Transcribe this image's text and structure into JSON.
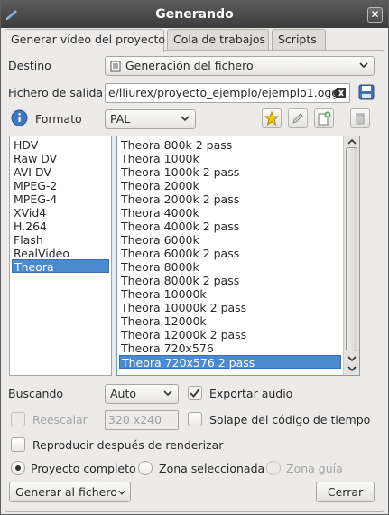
{
  "window": {
    "title": "Generando"
  },
  "tabs": [
    {
      "label": "Generar vídeo del proyecto"
    },
    {
      "label": "Cola de trabajos"
    },
    {
      "label": "Scripts"
    }
  ],
  "destination": {
    "label": "Destino",
    "value": "Generación del fichero"
  },
  "output_file": {
    "label": "Fichero de salida",
    "value": "e/lliurex/proyecto_ejemplo/ejemplo1.ogg"
  },
  "format": {
    "label": "Formato",
    "value": "PAL"
  },
  "categories": [
    "HDV",
    "Raw DV",
    "AVI DV",
    "MPEG-2",
    "MPEG-4",
    "XVid4",
    "H.264",
    "Flash",
    "RealVideo",
    "Theora"
  ],
  "selected_category": "Theora",
  "profiles": [
    "Theora 800k 2 pass",
    "Theora 1000k",
    "Theora 1000k 2 pass",
    "Theora 2000k",
    "Theora 2000k 2 pass",
    "Theora 4000k",
    "Theora 4000k 2 pass",
    "Theora 6000k",
    "Theora 6000k 2 pass",
    "Theora 8000k",
    "Theora 8000k 2 pass",
    "Theora 10000k",
    "Theora 10000k 2 pass",
    "Theora 12000k",
    "Theora 12000k 2 pass",
    "Theora 720x576",
    "Theora 720x576 2 pass"
  ],
  "selected_profile": "Theora 720x576 2 pass",
  "search": {
    "label": "Buscando",
    "value": "Auto"
  },
  "export_audio": {
    "label": "Exportar audio",
    "checked": true
  },
  "rescale": {
    "label": "Reescalar",
    "value": "320 x240",
    "checked": false
  },
  "timecode_overlay": {
    "label": "Solape del código de tiempo",
    "checked": false
  },
  "play_after": {
    "label": "Reproducir después de renderizar",
    "checked": false
  },
  "range": {
    "full_project": "Proyecto completo",
    "selected_zone": "Zona seleccionada",
    "guide_zone": "Zona guía"
  },
  "buttons": {
    "render": "Generar al fichero",
    "close": "Cerrar"
  }
}
